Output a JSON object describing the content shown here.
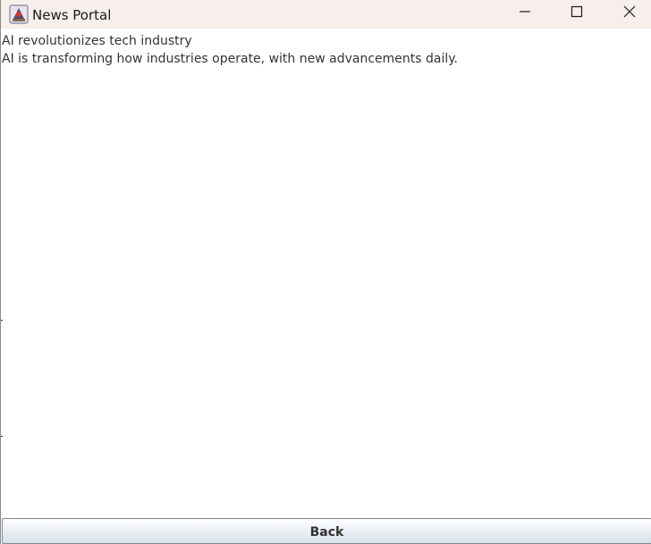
{
  "window": {
    "title": "News Portal",
    "app_icon": "java-coffee-icon",
    "controls": [
      "minimize-icon",
      "maximize-icon",
      "close-icon"
    ]
  },
  "article": {
    "headline": "AI revolutionizes tech industry",
    "body": "AI is transforming how industries operate, with new advancements daily."
  },
  "footer": {
    "back_label": "Back"
  },
  "colors": {
    "titlebar_bg": "#f7efec",
    "text": "#333333",
    "button_border": "#7a8a99"
  }
}
